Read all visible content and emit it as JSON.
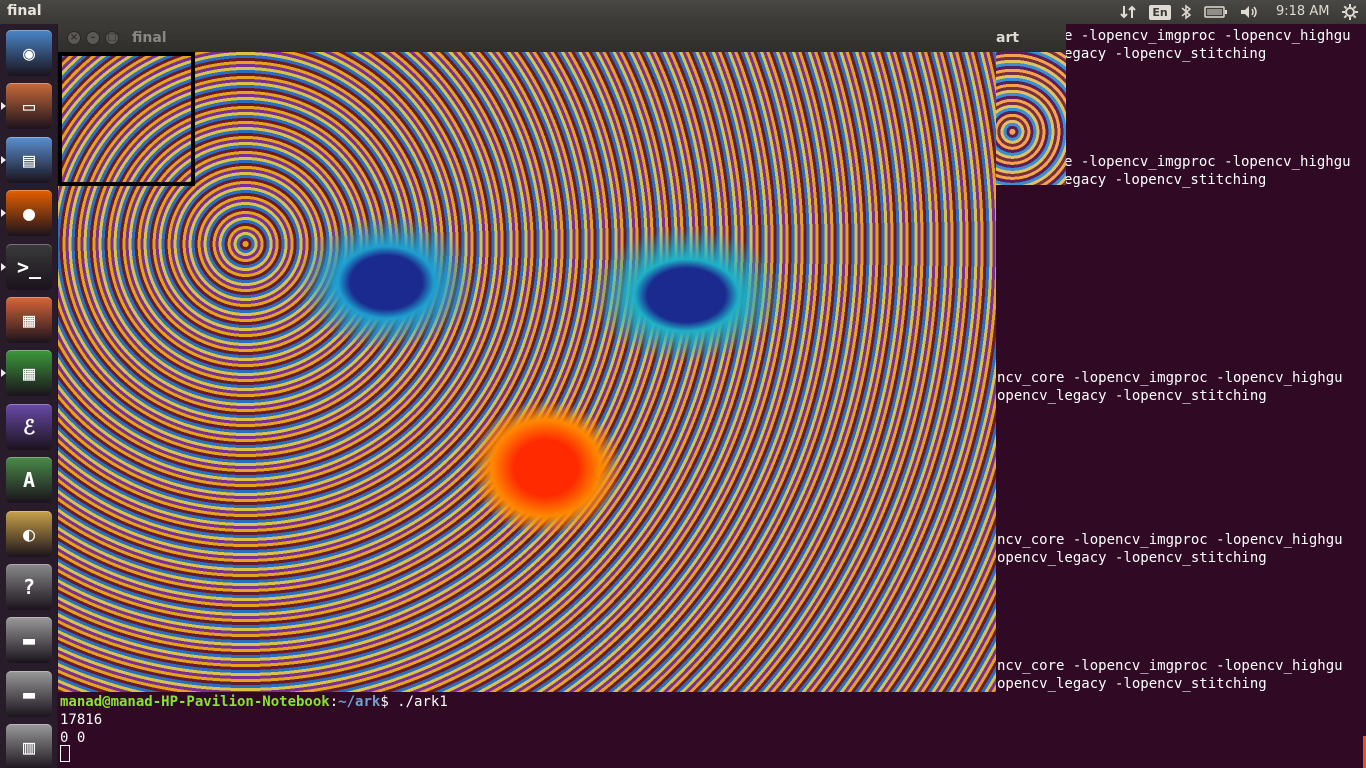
{
  "top_panel": {
    "app_title": "final",
    "keyboard_layout": "En",
    "clock": "9:18 AM",
    "indicators": [
      "network-arrows-icon",
      "keyboard-layout",
      "bluetooth-icon",
      "battery-icon",
      "volume-icon",
      "clock",
      "settings-gear-icon"
    ]
  },
  "launcher": {
    "items": [
      {
        "name": "ubuntu-dash-icon",
        "color": "#4a86c8"
      },
      {
        "name": "files-icon",
        "color": "#c96a3a"
      },
      {
        "name": "document-viewer-icon",
        "color": "#5a8fd0"
      },
      {
        "name": "firefox-icon",
        "color": "#e66000"
      },
      {
        "name": "terminal-icon",
        "color": "#3a3a3a"
      },
      {
        "name": "impress-icon",
        "color": "#d9663a"
      },
      {
        "name": "calc-icon",
        "color": "#3c9a3c"
      },
      {
        "name": "emacs-icon",
        "color": "#6a4aa8"
      },
      {
        "name": "software-updater-icon",
        "color": "#4a8a4a"
      },
      {
        "name": "image-viewer-icon",
        "color": "#c9a24a"
      },
      {
        "name": "help-icon",
        "color": "#8a8a8a"
      },
      {
        "name": "drive-icon",
        "color": "#9a9a9a"
      },
      {
        "name": "drive-icon",
        "color": "#9a9a9a"
      },
      {
        "name": "trash-icon",
        "color": "#9a9a9a"
      }
    ]
  },
  "terminal": {
    "compile_part1": "e -lopencv_imgproc -lopencv_highgu",
    "compile_part2": "egacy -lopencv_stitching",
    "compile_part3": "ncv_core -lopencv_imgproc -lopencv_highgu",
    "compile_part4": "opencv_legacy -lopencv_stitching",
    "prompt_user": "manad@manad-HP-Pavilion-Notebook",
    "prompt_sep": ":",
    "prompt_path": "~/ark",
    "prompt_cmd": "$ ./ark1",
    "output_line1": "17816",
    "output_line2": "0 0"
  },
  "final_window": {
    "title": "final",
    "close_glyph": "×",
    "minimize_glyph": "–",
    "maximize_glyph": "□"
  },
  "part_window": {
    "title": "part",
    "close_glyph": "×",
    "minimize_glyph": "–"
  },
  "colors": {
    "terminal_bg": "#300a24",
    "prompt_user": "#8ae234",
    "prompt_path": "#729fcf",
    "close_button": "#e95420"
  }
}
